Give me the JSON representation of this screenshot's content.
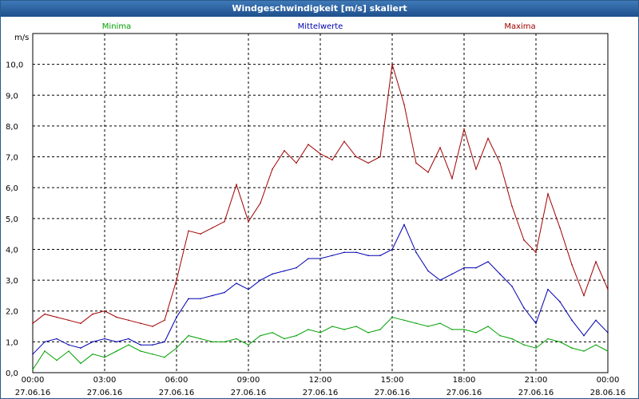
{
  "window": {
    "title": "Windgeschwindigkeit [m/s] skaliert"
  },
  "chart_data": {
    "type": "line",
    "title": "Windgeschwindigkeit [m/s] skaliert",
    "ylabel": "m/s",
    "ylim": [
      0,
      11
    ],
    "yticks": [
      "0,0",
      "1,0",
      "2,0",
      "3,0",
      "4,0",
      "5,0",
      "6,0",
      "7,0",
      "8,0",
      "9,0",
      "10,0"
    ],
    "xlim": [
      0,
      24
    ],
    "xticks": [
      {
        "time": "00:00",
        "date": "27.06.16"
      },
      {
        "time": "03:00",
        "date": "27.06.16"
      },
      {
        "time": "06:00",
        "date": "27.06.16"
      },
      {
        "time": "09:00",
        "date": "27.06.16"
      },
      {
        "time": "12:00",
        "date": "27.06.16"
      },
      {
        "time": "15:00",
        "date": "27.06.16"
      },
      {
        "time": "18:00",
        "date": "27.06.16"
      },
      {
        "time": "21:00",
        "date": "27.06.16"
      },
      {
        "time": "00:00",
        "date": "28.06.16"
      }
    ],
    "grid": true,
    "x_hours": [
      0,
      0.5,
      1,
      1.5,
      2,
      2.5,
      3,
      3.5,
      4,
      4.5,
      5,
      5.5,
      6,
      6.5,
      7,
      7.5,
      8,
      8.5,
      9,
      9.5,
      10,
      10.5,
      11,
      11.5,
      12,
      12.5,
      13,
      13.5,
      14,
      14.5,
      15,
      15.5,
      16,
      16.5,
      17,
      17.5,
      18,
      18.5,
      19,
      19.5,
      20,
      20.5,
      21,
      21.5,
      22,
      22.5,
      23,
      23.5,
      24
    ],
    "series": [
      {
        "name": "Minima",
        "color": "#00a000",
        "values": [
          0.1,
          0.7,
          0.4,
          0.7,
          0.3,
          0.6,
          0.5,
          0.7,
          0.9,
          0.7,
          0.6,
          0.5,
          0.8,
          1.2,
          1.1,
          1.0,
          1.0,
          1.1,
          0.9,
          1.2,
          1.3,
          1.1,
          1.2,
          1.4,
          1.3,
          1.5,
          1.4,
          1.5,
          1.3,
          1.4,
          1.8,
          1.7,
          1.6,
          1.5,
          1.6,
          1.4,
          1.4,
          1.3,
          1.5,
          1.2,
          1.1,
          0.9,
          0.8,
          1.1,
          1.0,
          0.8,
          0.7,
          0.9,
          0.7
        ]
      },
      {
        "name": "Mittelwerte",
        "color": "#0000b0",
        "values": [
          0.6,
          1.0,
          1.1,
          0.9,
          0.8,
          1.0,
          1.1,
          1.0,
          1.1,
          0.9,
          0.9,
          1.0,
          1.8,
          2.4,
          2.4,
          2.5,
          2.6,
          2.9,
          2.7,
          3.0,
          3.2,
          3.3,
          3.4,
          3.7,
          3.7,
          3.8,
          3.9,
          3.9,
          3.8,
          3.8,
          4.0,
          4.8,
          3.9,
          3.3,
          3.0,
          3.2,
          3.4,
          3.4,
          3.6,
          3.2,
          2.8,
          2.1,
          1.6,
          2.7,
          2.3,
          1.7,
          1.2,
          1.7,
          1.3
        ]
      },
      {
        "name": "Maxima",
        "color": "#a00000",
        "values": [
          1.6,
          1.9,
          1.8,
          1.7,
          1.6,
          1.9,
          2.0,
          1.8,
          1.7,
          1.6,
          1.5,
          1.7,
          3.0,
          4.6,
          4.5,
          4.7,
          4.9,
          6.1,
          4.9,
          5.5,
          6.6,
          7.2,
          6.8,
          7.4,
          7.1,
          6.9,
          7.5,
          7.0,
          6.8,
          7.0,
          10.0,
          8.7,
          6.8,
          6.5,
          7.3,
          6.3,
          7.9,
          6.6,
          7.6,
          6.8,
          5.4,
          4.3,
          3.9,
          5.8,
          4.7,
          3.5,
          2.5,
          3.6,
          2.7
        ]
      }
    ]
  }
}
